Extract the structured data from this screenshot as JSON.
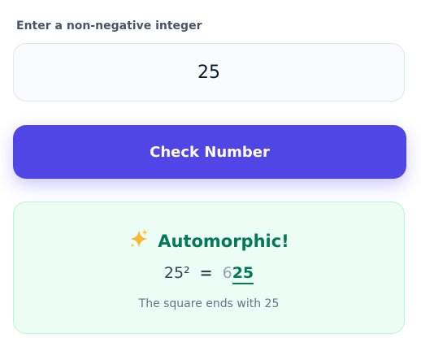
{
  "form": {
    "label": "Enter a non-negative integer",
    "input_value": "25",
    "button_label": "Check Number"
  },
  "result": {
    "icon": "sparkles-icon",
    "title": "Automorphic!",
    "number": "25",
    "power": "²",
    "equals": "=",
    "square_prefix": "6",
    "square_suffix": "25",
    "explanation": "The square ends with 25"
  },
  "colors": {
    "accent": "#4f46e5",
    "success": "#047857",
    "card_background": "#ecfdf5"
  }
}
